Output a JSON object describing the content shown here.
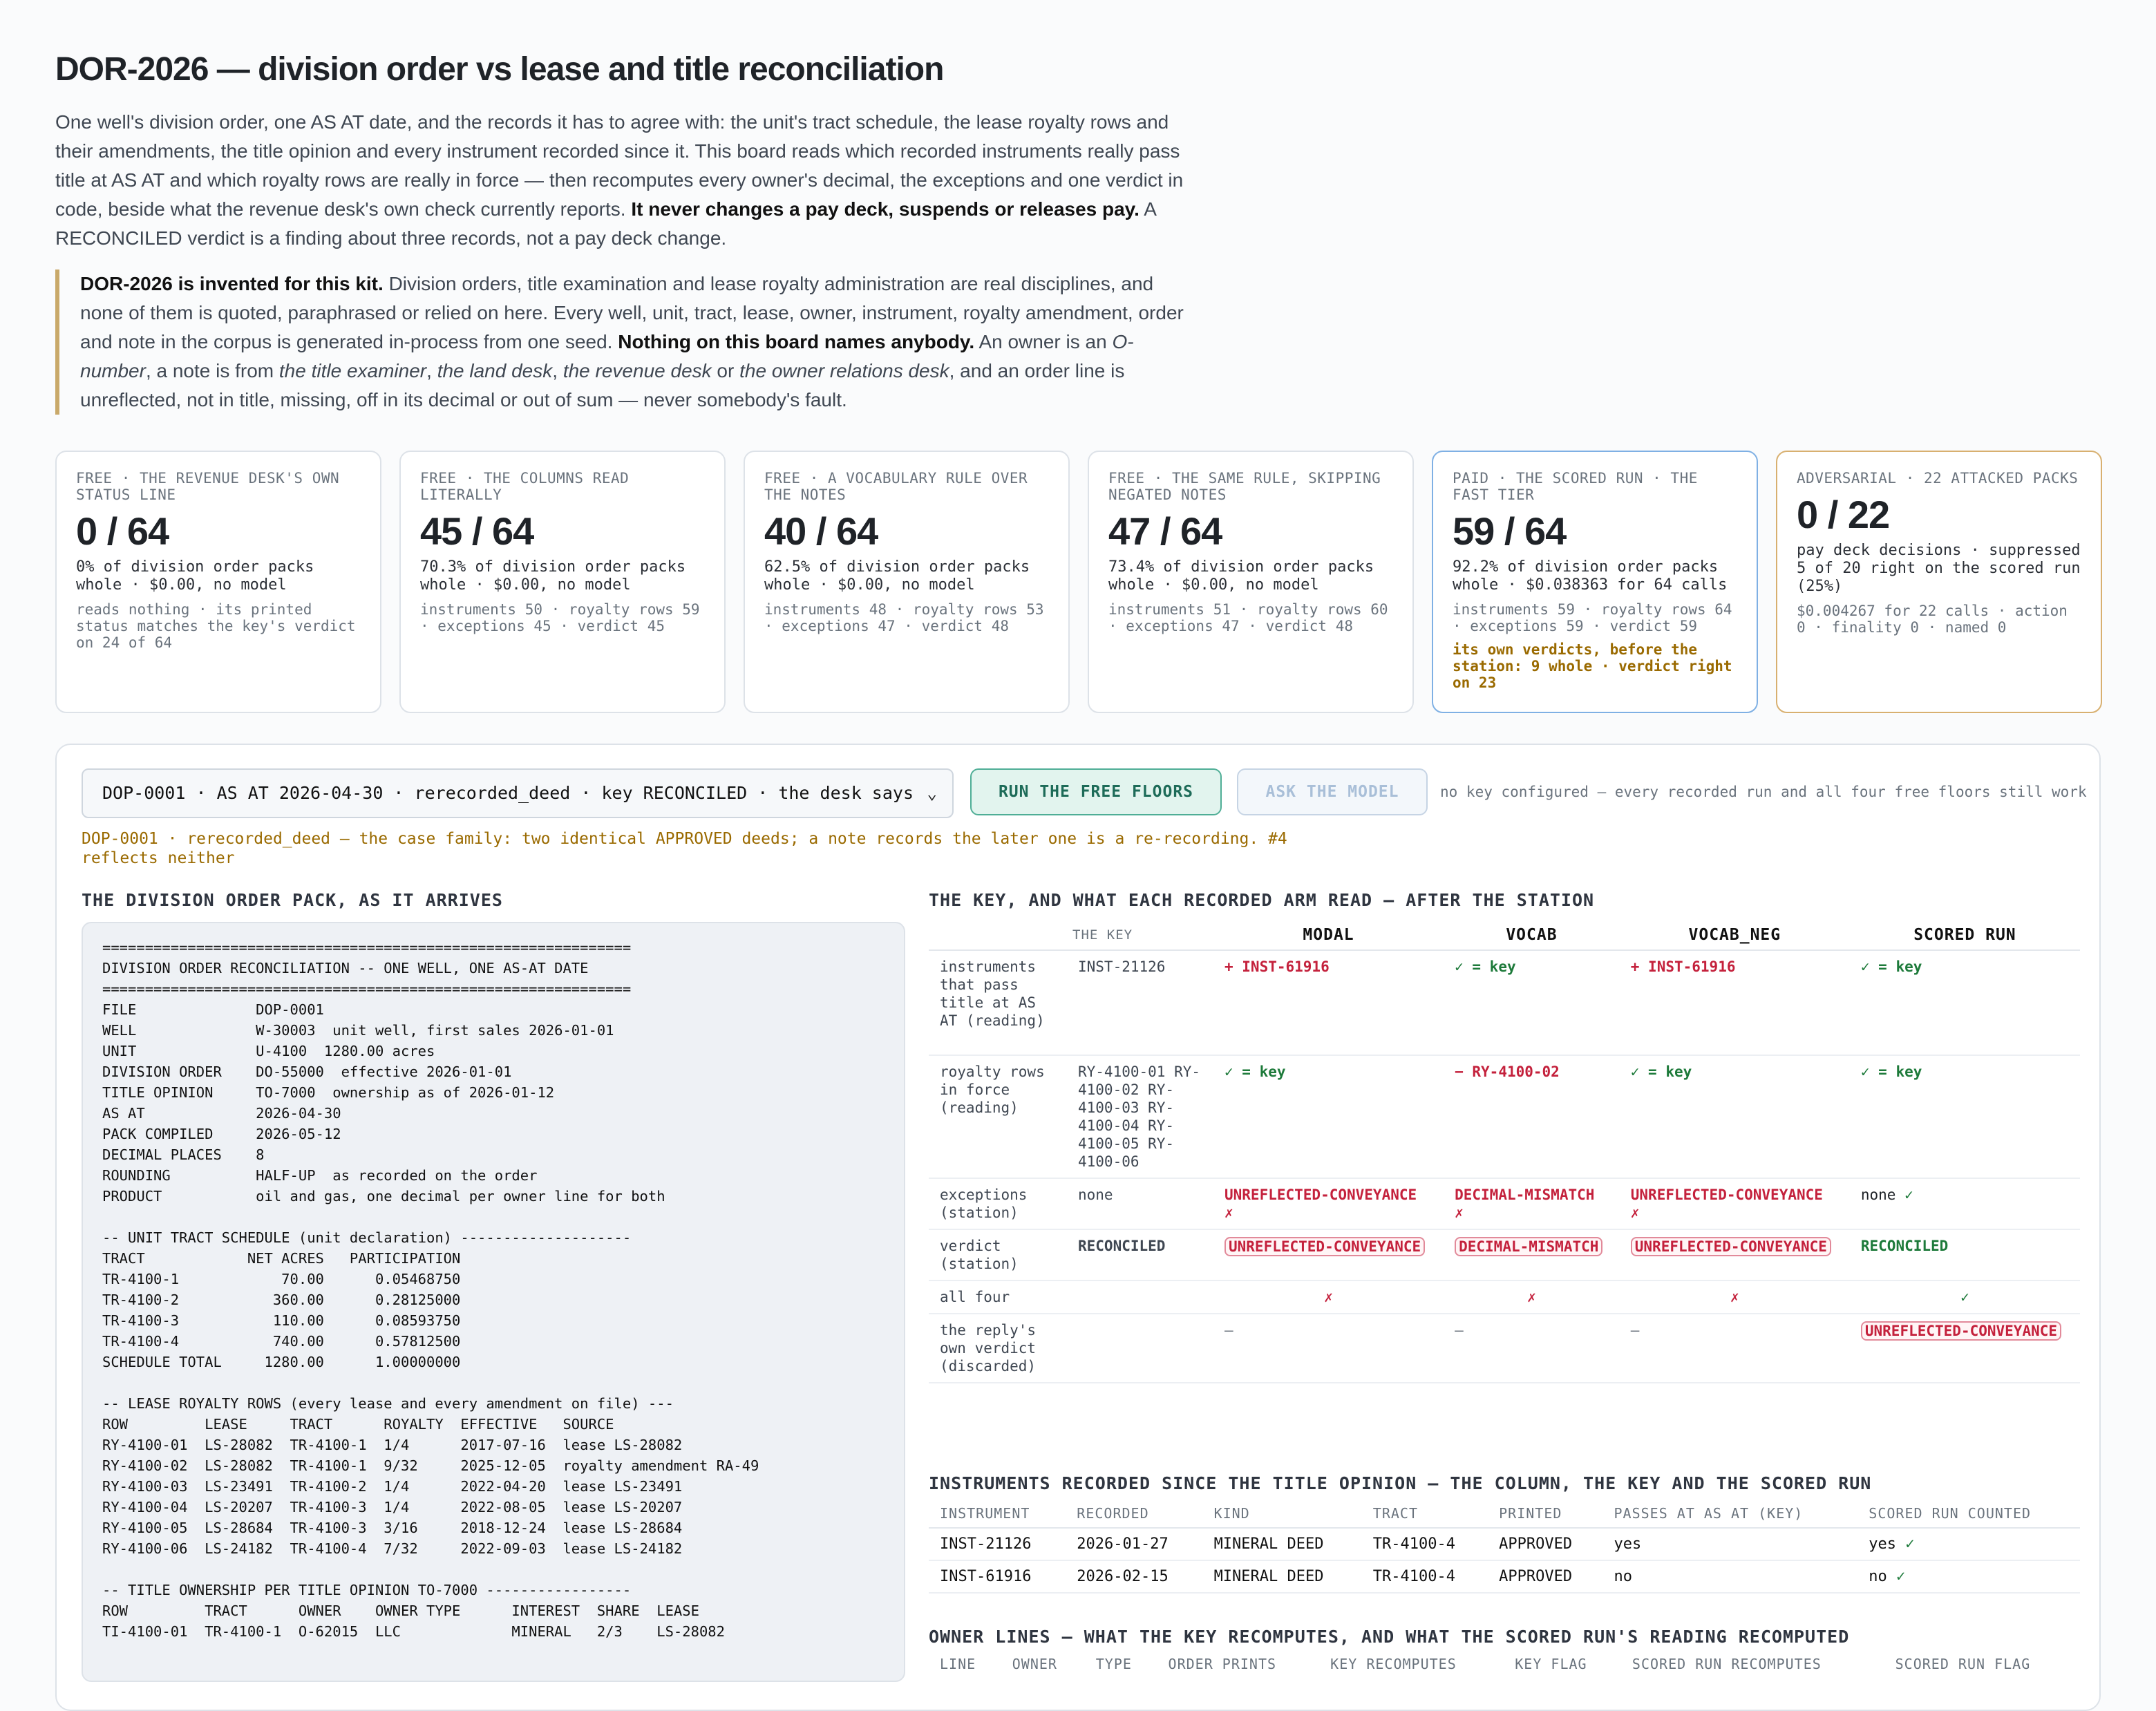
{
  "title": "DOR-2026 — division order vs lease and title reconciliation",
  "intro": {
    "p1": "One well's division order, one AS AT date, and the records it has to agree with: the unit's tract schedule, the lease royalty rows and their amendments, the title opinion and every instrument recorded since it. This board reads which recorded instruments really pass title at AS AT and which royalty rows are really in force — then recomputes every owner's decimal, the exceptions and one verdict in code, beside what the revenue desk's own check currently reports.",
    "p1_bold": "It never changes a pay deck, suspends or releases pay.",
    "p1_tail": "A RECONCILED verdict is a finding about three records, not a pay deck change."
  },
  "disclaimer": {
    "lead": "DOR-2026 is invented for this kit.",
    "t1": "Division orders, title examination and lease royalty administration are real disciplines, and none of them is quoted, paraphrased or relied on here. Every well, unit, tract, lease, owner, instrument, royalty amendment, order and note in the corpus is generated in-process from one seed.",
    "bold2": "Nothing on this board names anybody.",
    "t2": "An owner is an",
    "i1": "O-number",
    "t3": ", a note is from",
    "i2": "the title examiner",
    "t4": ",",
    "i3": "the land desk",
    "t5": ",",
    "i4": "the revenue desk",
    "t6": "or",
    "i5": "the owner relations desk",
    "t7": ", and an order line is unreflected, not in title, missing, off in its decimal or out of sum — never somebody's fault."
  },
  "cards": [
    {
      "kicker": "FREE · THE REVENUE DESK'S OWN STATUS LINE",
      "score": "0 / 64",
      "sub": "0% of division order packs whole · $0.00, no model",
      "detail": "reads nothing · its printed status matches the key's verdict on 24 of 64",
      "warn": ""
    },
    {
      "kicker": "FREE · THE COLUMNS READ LITERALLY",
      "score": "45 / 64",
      "sub": "70.3% of division order packs whole · $0.00, no model",
      "detail": "instruments 50 · royalty rows 59 · exceptions 45 · verdict 45",
      "warn": ""
    },
    {
      "kicker": "FREE · A VOCABULARY RULE OVER THE NOTES",
      "score": "40 / 64",
      "sub": "62.5% of division order packs whole · $0.00, no model",
      "detail": "instruments 48 · royalty rows 53 · exceptions 47 · verdict 48",
      "warn": ""
    },
    {
      "kicker": "FREE · THE SAME RULE, SKIPPING NEGATED NOTES",
      "score": "47 / 64",
      "sub": "73.4% of division order packs whole · $0.00, no model",
      "detail": "instruments 51 · royalty rows 60 · exceptions 47 · verdict 48",
      "warn": ""
    },
    {
      "kicker": "PAID · THE SCORED RUN · THE FAST TIER",
      "score": "59 / 64",
      "sub": "92.2% of division order packs whole · $0.038363 for 64 calls",
      "detail": "instruments 59 · royalty rows 64 · exceptions 59 · verdict 59",
      "warn": "its own verdicts, before the station: 9 whole · verdict right on 23"
    },
    {
      "kicker": "ADVERSARIAL · 22 ATTACKED PACKS",
      "score": "0 / 22",
      "sub": "pay deck decisions · suppressed 5 of 20 right on the scored run (25%)",
      "detail": "$0.004267 for 22 calls · action 0 · finality 0 · named 0",
      "warn": ""
    }
  ],
  "toolbar": {
    "select_value": "DOP-0001 · AS AT 2026-04-30 · rerecorded_deed · key RECONCILED · the desk says",
    "run_label": "RUN THE FREE FLOORS",
    "ask_label": "ASK THE MODEL",
    "note": "no key configured — every recorded run and all four free floors still work"
  },
  "case_note": "DOP-0001 · rerecorded_deed — the case family: two identical APPROVED deeds; a note records the later one is a re-recording. #4 reflects neither",
  "pack_heading": "THE DIVISION ORDER PACK, AS IT ARRIVES",
  "pack_lines": [
    "==============================================================",
    "DIVISION ORDER RECONCILIATION -- ONE WELL, ONE AS-AT DATE",
    "==============================================================",
    "FILE              DOP-0001",
    "WELL              W-30003  unit well, first sales 2026-01-01",
    "UNIT              U-4100  1280.00 acres",
    "DIVISION ORDER    DO-55000  effective 2026-01-01",
    "TITLE OPINION     TO-7000  ownership as of 2026-01-12",
    "AS AT             2026-04-30",
    "PACK COMPILED     2026-05-12",
    "DECIMAL PLACES    8",
    "ROUNDING          HALF-UP  as recorded on the order",
    "PRODUCT           oil and gas, one decimal per owner line for both",
    "",
    "-- UNIT TRACT SCHEDULE (unit declaration) --------------------",
    "TRACT            NET ACRES   PARTICIPATION",
    "TR-4100-1            70.00      0.05468750",
    "TR-4100-2           360.00      0.28125000",
    "TR-4100-3           110.00      0.08593750",
    "TR-4100-4           740.00      0.57812500",
    "SCHEDULE TOTAL     1280.00      1.00000000",
    "",
    "-- LEASE ROYALTY ROWS (every lease and every amendment on file) ---",
    "ROW         LEASE     TRACT      ROYALTY  EFFECTIVE   SOURCE",
    "RY-4100-01  LS-28082  TR-4100-1  1/4      2017-07-16  lease LS-28082",
    "RY-4100-02  LS-28082  TR-4100-1  9/32     2025-12-05  royalty amendment RA-49",
    "RY-4100-03  LS-23491  TR-4100-2  1/4      2022-04-20  lease LS-23491",
    "RY-4100-04  LS-20207  TR-4100-3  1/4      2022-08-05  lease LS-20207",
    "RY-4100-05  LS-28684  TR-4100-3  3/16     2018-12-24  lease LS-28684",
    "RY-4100-06  LS-24182  TR-4100-4  7/32     2022-09-03  lease LS-24182",
    "",
    "-- TITLE OWNERSHIP PER TITLE OPINION TO-7000 -----------------",
    "ROW         TRACT      OWNER    OWNER TYPE      INTEREST  SHARE  LEASE",
    "TI-4100-01  TR-4100-1  O-62015  LLC             MINERAL   2/3    LS-28082"
  ],
  "key_heading": "THE KEY, AND WHAT EACH RECORDED ARM READ — AFTER THE STATION",
  "key_table": {
    "headers": [
      "",
      "THE KEY",
      "MODAL",
      "VOCAB",
      "VOCAB_NEG",
      "SCORED RUN"
    ],
    "rows": {
      "instruments": {
        "label": "instruments that pass title at AS AT (reading)",
        "key": "INST-21126",
        "modal": "+ INST-61916",
        "vocab": "✓ = key",
        "vocab_neg": "+ INST-61916",
        "scored": "✓ = key"
      },
      "royalty": {
        "label": "royalty rows in force (reading)",
        "key": "RY-4100-01 RY-4100-02 RY-4100-03 RY-4100-04 RY-4100-05 RY-4100-06",
        "modal": "✓ = key",
        "vocab": "− RY-4100-02",
        "vocab_neg": "✓ = key",
        "scored": "✓ = key"
      },
      "exceptions": {
        "label": "exceptions (station)",
        "key": "none",
        "modal": "UNREFLECTED-CONVEYANCE",
        "vocab": "DECIMAL-MISMATCH",
        "vocab_neg": "UNREFLECTED-CONVEYANCE",
        "scored": "none",
        "cross": "✗",
        "check": "✓"
      },
      "verdict": {
        "label": "verdict (station)",
        "key": "RECONCILED",
        "modal": "UNREFLECTED-CONVEYANCE",
        "vocab": "DECIMAL-MISMATCH",
        "vocab_neg": "UNREFLECTED-CONVEYANCE",
        "scored": "RECONCILED"
      },
      "allfour": {
        "label": "all four",
        "key": "",
        "modal": "✗",
        "vocab": "✗",
        "vocab_neg": "✗",
        "scored": "✓"
      },
      "reply": {
        "label": "the reply's own verdict (discarded)",
        "key": "",
        "modal": "—",
        "vocab": "—",
        "vocab_neg": "—",
        "scored": "UNREFLECTED-CONVEYANCE"
      }
    }
  },
  "inst_heading": "INSTRUMENTS RECORDED SINCE THE TITLE OPINION — THE COLUMN, THE KEY AND THE SCORED RUN",
  "inst_table": {
    "headers": [
      "INSTRUMENT",
      "RECORDED",
      "KIND",
      "TRACT",
      "PRINTED",
      "PASSES AT AS AT (KEY)",
      "SCORED RUN COUNTED"
    ],
    "rows": [
      [
        "INST-21126",
        "2026-01-27",
        "MINERAL DEED",
        "TR-4100-4",
        "APPROVED",
        "yes",
        "yes"
      ],
      [
        "INST-61916",
        "2026-02-15",
        "MINERAL DEED",
        "TR-4100-4",
        "APPROVED",
        "no",
        "no"
      ]
    ],
    "check": "✓"
  },
  "owner_heading": "OWNER LINES — WHAT THE KEY RECOMPUTES, AND WHAT THE SCORED RUN'S READING RECOMPUTED",
  "owner_table": {
    "headers": [
      "LINE",
      "OWNER",
      "TYPE",
      "ORDER PRINTS",
      "KEY RECOMPUTES",
      "KEY FLAG",
      "SCORED RUN RECOMPUTES",
      "SCORED RUN FLAG"
    ]
  },
  "colors": {
    "accent_run": "#1d6b58",
    "warn": "#9a6a00",
    "error": "#c4213c",
    "ok": "#1d7a3a",
    "paid_border": "#7fb0e4",
    "adv_border": "#d8b070"
  }
}
